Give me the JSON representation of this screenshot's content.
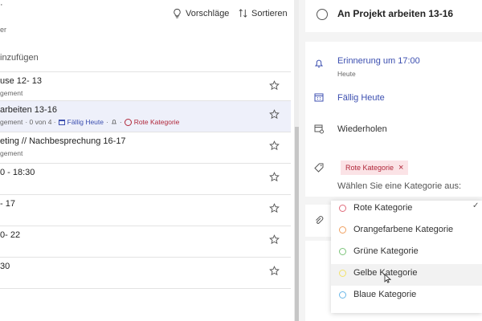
{
  "list": {
    "title_fragment": "·",
    "subtitle": "er",
    "suggestions_label": "Vorschläge",
    "sort_label": "Sortieren",
    "add_task_label": "inzufügen",
    "tasks": [
      {
        "title": "use 12- 13",
        "meta": "gement"
      },
      {
        "title": "arbeiten 13-16",
        "meta": "gement",
        "progress": "· 0 von 4 ·",
        "due": "Fällig Heute",
        "category": "Rote Kategorie",
        "selected": true
      },
      {
        "title": "eting // Nachbesprechung 16-17",
        "meta": "gement"
      },
      {
        "title": "0 - 18:30",
        "meta": ""
      },
      {
        "title": "- 17",
        "meta": ""
      },
      {
        "title": "0- 22",
        "meta": ""
      },
      {
        "title": "30",
        "meta": ""
      }
    ]
  },
  "detail": {
    "task_title": "An Projekt arbeiten 13-16",
    "reminder_label": "Erinnerung um 17:00",
    "reminder_sub": "Heute",
    "due_label": "Fällig Heute",
    "repeat_label": "Wiederholen",
    "category_chip": "Rote Kategorie",
    "category_hint": "Wählen Sie eine Kategorie aus:"
  },
  "category_options": [
    {
      "label": "Rote Kategorie",
      "color": "#e06b7a",
      "checked": true
    },
    {
      "label": "Orangefarbene Kategorie",
      "color": "#f0a060"
    },
    {
      "label": "Grüne Kategorie",
      "color": "#7cc47a"
    },
    {
      "label": "Gelbe Kategorie",
      "color": "#f2e26a",
      "hovered": true
    },
    {
      "label": "Blaue Kategorie",
      "color": "#6ab7e8"
    }
  ],
  "colors": {
    "accent_blue": "#3c4fb0",
    "category_red": "#b0273a",
    "chip_bg": "#fbe3e6",
    "selected_row_bg": "#eef0fa"
  },
  "icons": [
    "lightbulb-icon",
    "sort-icon",
    "star-icon",
    "calendar-icon",
    "bell-icon",
    "circle-icon",
    "repeat-icon",
    "tag-icon",
    "paperclip-icon",
    "checkmark-icon"
  ]
}
